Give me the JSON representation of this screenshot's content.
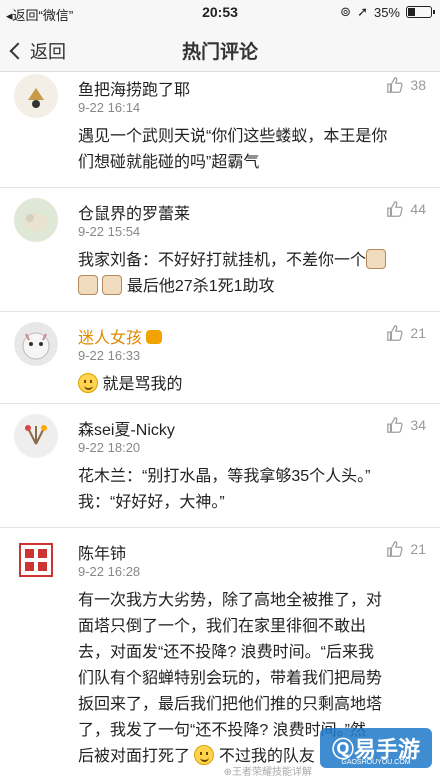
{
  "status_bar": {
    "back_app": "◂返回“微信”",
    "time": "20:53",
    "battery": "35%",
    "battery_level": 0.35
  },
  "nav": {
    "back_label": "返回",
    "title": "热门评论"
  },
  "comments": [
    {
      "name": "鱼把海捞跑了耶",
      "time": "9-22 16:14",
      "likes": "38",
      "lines": [
        "遇见一个武则天说“你们这些蝼蚁，本王是你",
        "们想碰就能碰的吗”超霸气"
      ]
    },
    {
      "name": "仓鼠界的罗蕾莱",
      "time": "9-22 15:54",
      "likes": "44",
      "line1": "我家刘备：不好好打就挂机，不差你一个",
      "line2": "最后他27杀1死1助攻"
    },
    {
      "name": "迷人女孩",
      "time": "9-22 16:33",
      "likes": "21",
      "text": "就是骂我的"
    },
    {
      "name": "森sei夏-Nicky",
      "time": "9-22 18:20",
      "likes": "34",
      "lines": [
        "花木兰：“别打水晶，等我拿够35个人头。”",
        "我：“好好好，大神。”"
      ]
    },
    {
      "name": "陈年铈",
      "time": "9-22 16:28",
      "likes": "21",
      "lines": [
        "有一次我方大劣势，除了高地全被推了，对",
        "面塔只倒了一个，我们在家里徘徊不敢出",
        "去，对面发“还不投降? 浪费时间。“后来我",
        "们队有个貂蝉特别会玩的，带着我们把局势",
        "扳回来了，最后我们把他们推的只剩高地塔",
        "了，我发了一句“还不投降? 浪费时间。”然",
        "后被对面打死了"
      ],
      "tail": "不过我的队友"
    }
  ],
  "watermark": {
    "brand": "Ⓠ易手游",
    "domain": "GAOSHOUYOU.COM",
    "weibo": "⊕王者荣耀技能详解"
  },
  "colors": {
    "accent_gold": "#e08a00",
    "text_gray": "#888888"
  }
}
